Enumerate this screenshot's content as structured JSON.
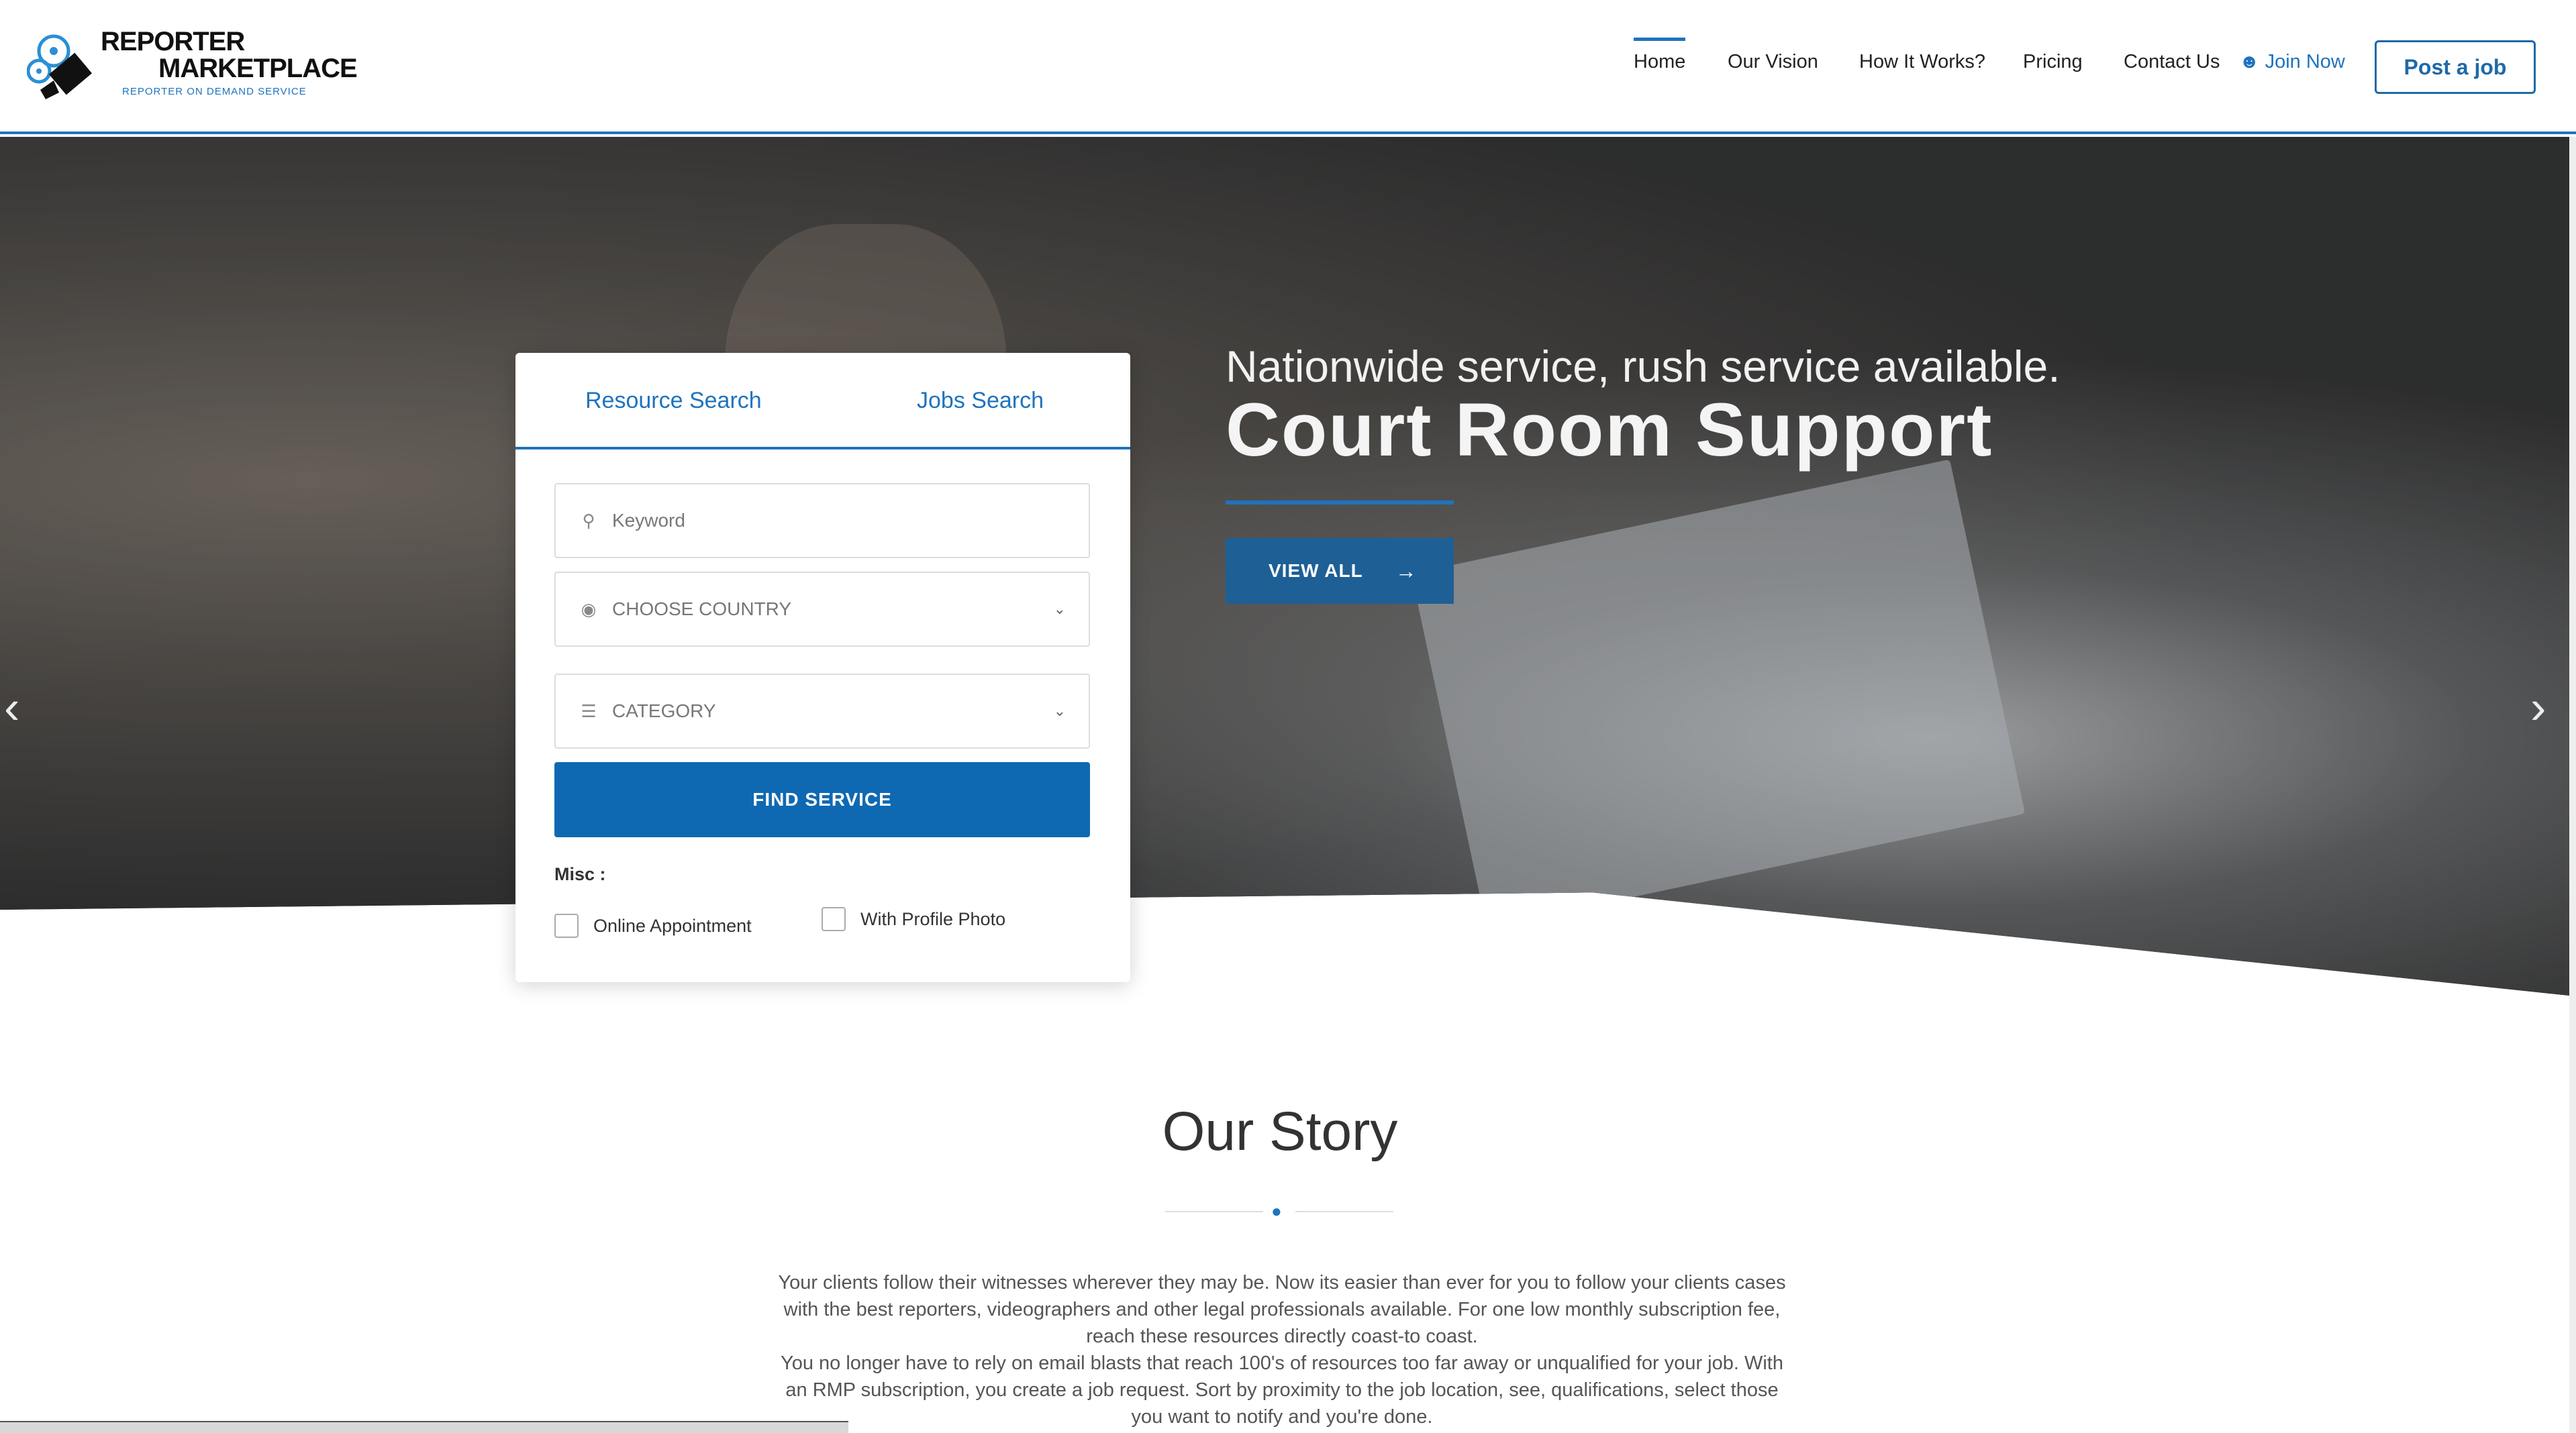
{
  "header": {
    "logo": {
      "line1": "REPORTER",
      "line2": "MARKETPLACE",
      "tagline": "REPORTER ON DEMAND SERVICE"
    },
    "nav": [
      {
        "label": "Home",
        "active": true
      },
      {
        "label": "Our Vision",
        "active": false
      },
      {
        "label": "How It Works?",
        "active": false
      },
      {
        "label": "Pricing",
        "active": false
      },
      {
        "label": "Contact Us",
        "active": false
      }
    ],
    "join_label": "Join Now",
    "post_job_label": "Post a job"
  },
  "hero": {
    "subtitle": "Nationwide service, rush service available.",
    "title": "Court Room Support",
    "cta_label": "VIEW ALL",
    "cta_icon": "arrow-right-icon",
    "slides_total": 6,
    "active_slide": 3
  },
  "search": {
    "tabs": [
      "Resource Search",
      "Jobs Search"
    ],
    "keyword_placeholder": "Keyword",
    "country_placeholder": "CHOOSE COUNTRY",
    "category_placeholder": "CATEGORY",
    "find_label": "FIND SERVICE",
    "misc_label": "Misc :",
    "options": [
      {
        "label": "Online Appointment",
        "checked": false
      },
      {
        "label": "With Profile Photo",
        "checked": false
      }
    ]
  },
  "story": {
    "title": "Our Story",
    "paragraph1": "Your clients follow their witnesses wherever they may be. Now its easier than ever for you to follow your clients cases with the best reporters, videographers and other legal professionals available. For one low monthly subscription fee, reach these resources directly coast-to coast.",
    "paragraph2": "You no longer have to rely on email blasts that reach 100's of resources too far away or unqualified for your job. With an RMP subscription, you create a job request. Sort by proximity to the job location, see, qualifications, select those you want to notify and you're done."
  },
  "colors": {
    "accent": "#1e73be",
    "button": "#0f69b2"
  }
}
